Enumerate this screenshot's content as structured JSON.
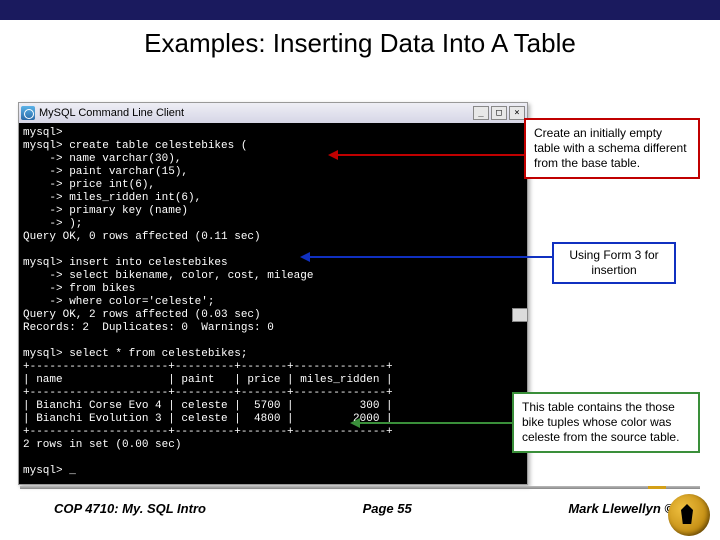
{
  "title": "Examples: Inserting Data Into A Table",
  "terminal": {
    "window_title": "MySQL Command Line Client",
    "buttons": {
      "min": "_",
      "max": "□",
      "close": "×"
    },
    "content": "mysql>\nmysql> create table celestebikes (\n    -> name varchar(30),\n    -> paint varchar(15),\n    -> price int(6),\n    -> miles_ridden int(6),\n    -> primary key (name)\n    -> );\nQuery OK, 0 rows affected (0.11 sec)\n\nmysql> insert into celestebikes\n    -> select bikename, color, cost, mileage\n    -> from bikes\n    -> where color='celeste';\nQuery OK, 2 rows affected (0.03 sec)\nRecords: 2  Duplicates: 0  Warnings: 0\n\nmysql> select * from celestebikes;\n+---------------------+---------+-------+--------------+\n| name                | paint   | price | miles_ridden |\n+---------------------+---------+-------+--------------+\n| Bianchi Corse Evo 4 | celeste |  5700 |          300 |\n| Bianchi Evolution 3 | celeste |  4800 |         2000 |\n+---------------------+---------+-------+--------------+\n2 rows in set (0.00 sec)\n\nmysql> _"
  },
  "callouts": {
    "red": "Create an initially empty table with a schema different from the base table.",
    "blue": "Using Form 3 for insertion",
    "green": "This table contains the those bike tuples whose color was celeste from the source table."
  },
  "footer": {
    "left": "COP 4710: My. SQL Intro",
    "mid": "Page 55",
    "right": "Mark Llewellyn ©"
  }
}
